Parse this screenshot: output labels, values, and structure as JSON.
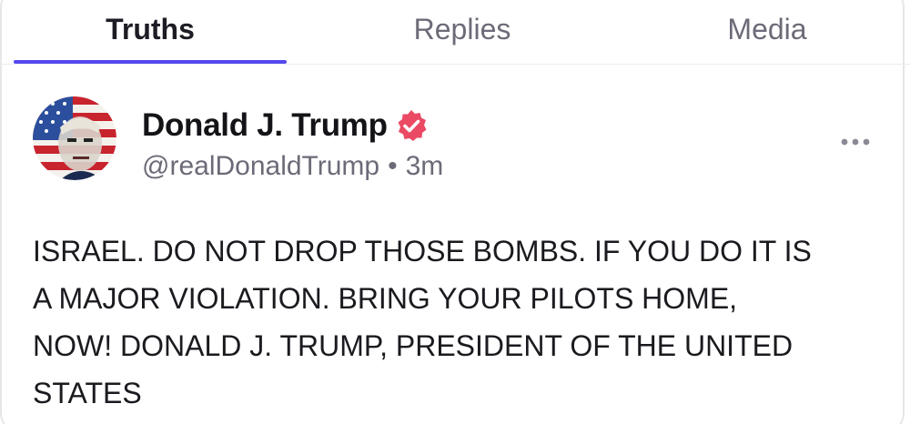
{
  "tabs": [
    {
      "label": "Truths",
      "active": true
    },
    {
      "label": "Replies",
      "active": false
    },
    {
      "label": "Media",
      "active": false
    }
  ],
  "post": {
    "author_name": "Donald J. Trump",
    "verified": true,
    "handle": "@realDonaldTrump",
    "separator": "•",
    "timestamp": "3m",
    "text": "ISRAEL. DO NOT DROP THOSE BOMBS. IF YOU DO IT IS\nA MAJOR VIOLATION. BRING YOUR PILOTS HOME,\nNOW! DONALD J. TRUMP, PRESIDENT OF THE UNITED\nSTATES"
  },
  "icons": {
    "verified": "verified-badge-icon",
    "more": "more-options-icon"
  },
  "colors": {
    "accent": "#5448ee",
    "verified_badge": "#ea4a64",
    "muted_text": "#6b6b78"
  }
}
